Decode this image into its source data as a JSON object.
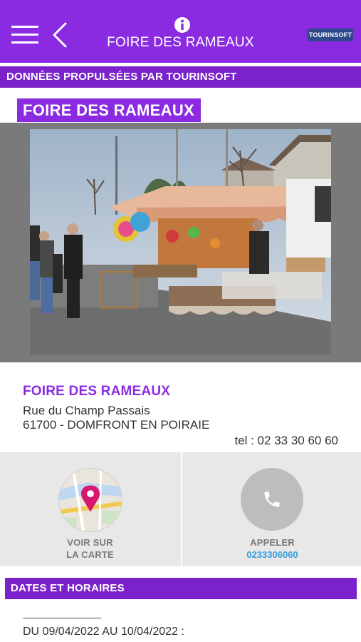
{
  "header": {
    "title": "FOIRE DES RAMEAUX",
    "logo_text": "TOURINSOFT"
  },
  "subheader": {
    "text": "DONNÉES PROPULSÉES PAR TOURINSOFT"
  },
  "event": {
    "name_tag": "FOIRE DES RAMEAUX",
    "name": "FOIRE DES RAMEAUX",
    "address_line1": "Rue du Champ Passais",
    "address_line2": "61700 - DOMFRONT EN POIRAIE",
    "tel": "tel : 02 33 30 60 60"
  },
  "actions": {
    "map_label_1": "VOIR SUR",
    "map_label_2": "LA CARTE",
    "call_label": "APPELER",
    "call_number": "0233306060"
  },
  "dates": {
    "section_title": "DATES ET HORAIRES",
    "separator": "------------------------------",
    "range": "DU 09/04/2022 AU 10/04/2022 :"
  },
  "colors": {
    "brand": "#8a2be2",
    "subbar": "#7b22cc",
    "link": "#3a9bdc"
  }
}
